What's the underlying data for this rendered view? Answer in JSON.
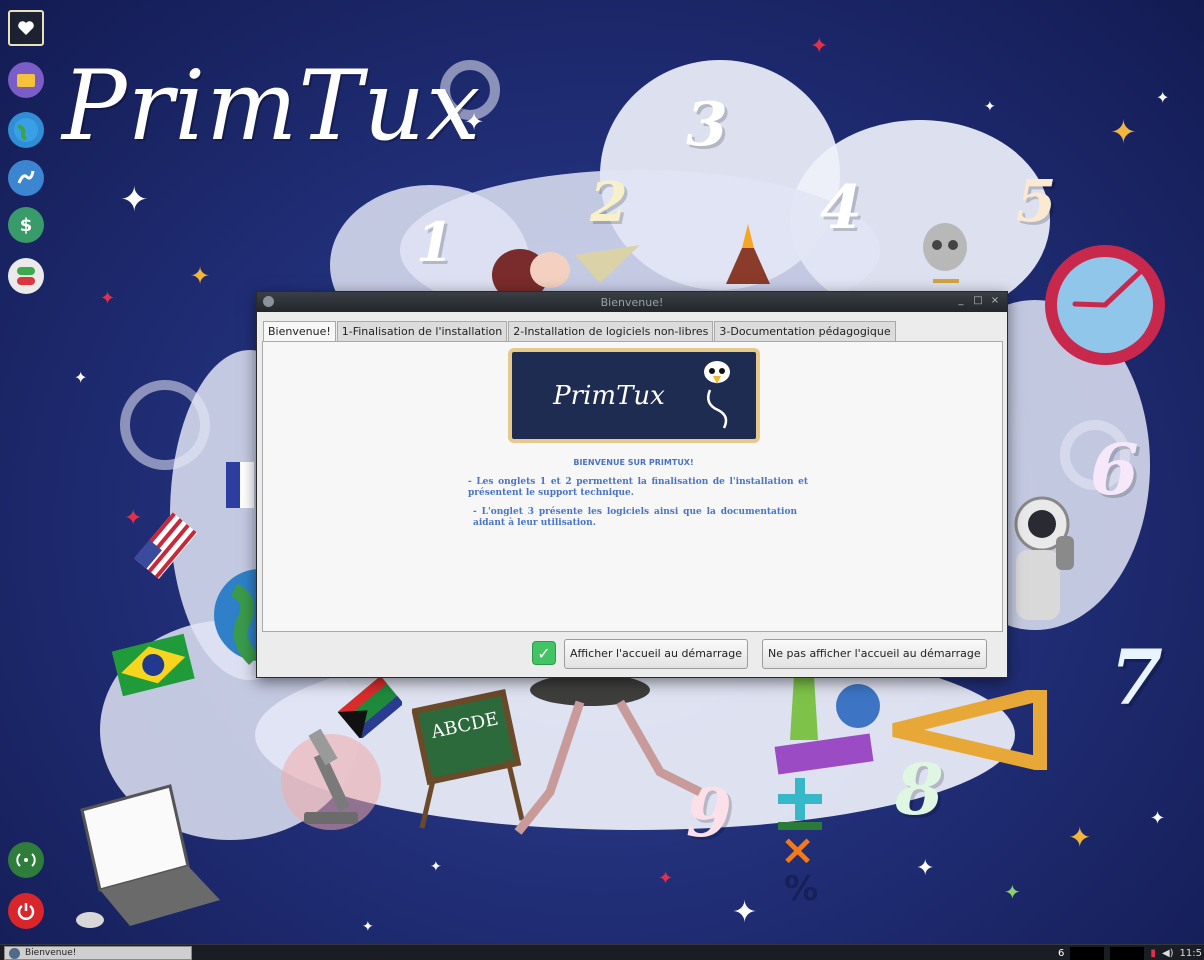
{
  "desktop": {
    "logo_text": "PrimTux",
    "wallpaper_numbers": [
      "1",
      "2",
      "3",
      "4",
      "5",
      "6",
      "7",
      "8",
      "9"
    ]
  },
  "dock": {
    "items": [
      {
        "name": "primtux-menu-icon",
        "glyph": "♥"
      },
      {
        "name": "folder-icon",
        "glyph": "▬"
      },
      {
        "name": "web-browser-icon",
        "glyph": "◍"
      },
      {
        "name": "handwriting-icon",
        "glyph": "✋"
      },
      {
        "name": "money-icon",
        "glyph": "$"
      },
      {
        "name": "toggle-switch-icon",
        "glyph": "◐"
      }
    ],
    "bottom": [
      {
        "name": "network-icon",
        "glyph": "((·))"
      },
      {
        "name": "power-icon",
        "glyph": "⏻"
      }
    ]
  },
  "window": {
    "title": "Bienvenue!",
    "tabs": [
      {
        "label": "Bienvenue!",
        "active": true
      },
      {
        "label": "1-Finalisation de l'installation",
        "active": false
      },
      {
        "label": "2-Installation de logiciels non-libres",
        "active": false
      },
      {
        "label": "3-Documentation pédagogique",
        "active": false
      }
    ],
    "banner_text": "PrimTux",
    "welcome": {
      "title": "BIENVENUE SUR PRIMTUX!",
      "p1": "- Les onglets 1 et 2 permettent la finalisation de l'installation et présentent le support technique.",
      "p2": "- L'onglet 3 présente les logiciels ainsi que la documentation aidant à leur utilisation."
    },
    "buttons": {
      "show": "Afficher l'accueil au démarrage",
      "hide": "Ne pas afficher l'accueil au démarrage"
    },
    "checkbox_checked": true
  },
  "taskbar": {
    "task_label": "Bienvenue!",
    "clock": "11:5"
  },
  "colors": {
    "accent_text": "#4a74c4",
    "check_green": "#43c464",
    "banner_bg": "#1f2c52",
    "banner_border": "#e7c98b",
    "wallpaper_blue": "#22307a"
  }
}
